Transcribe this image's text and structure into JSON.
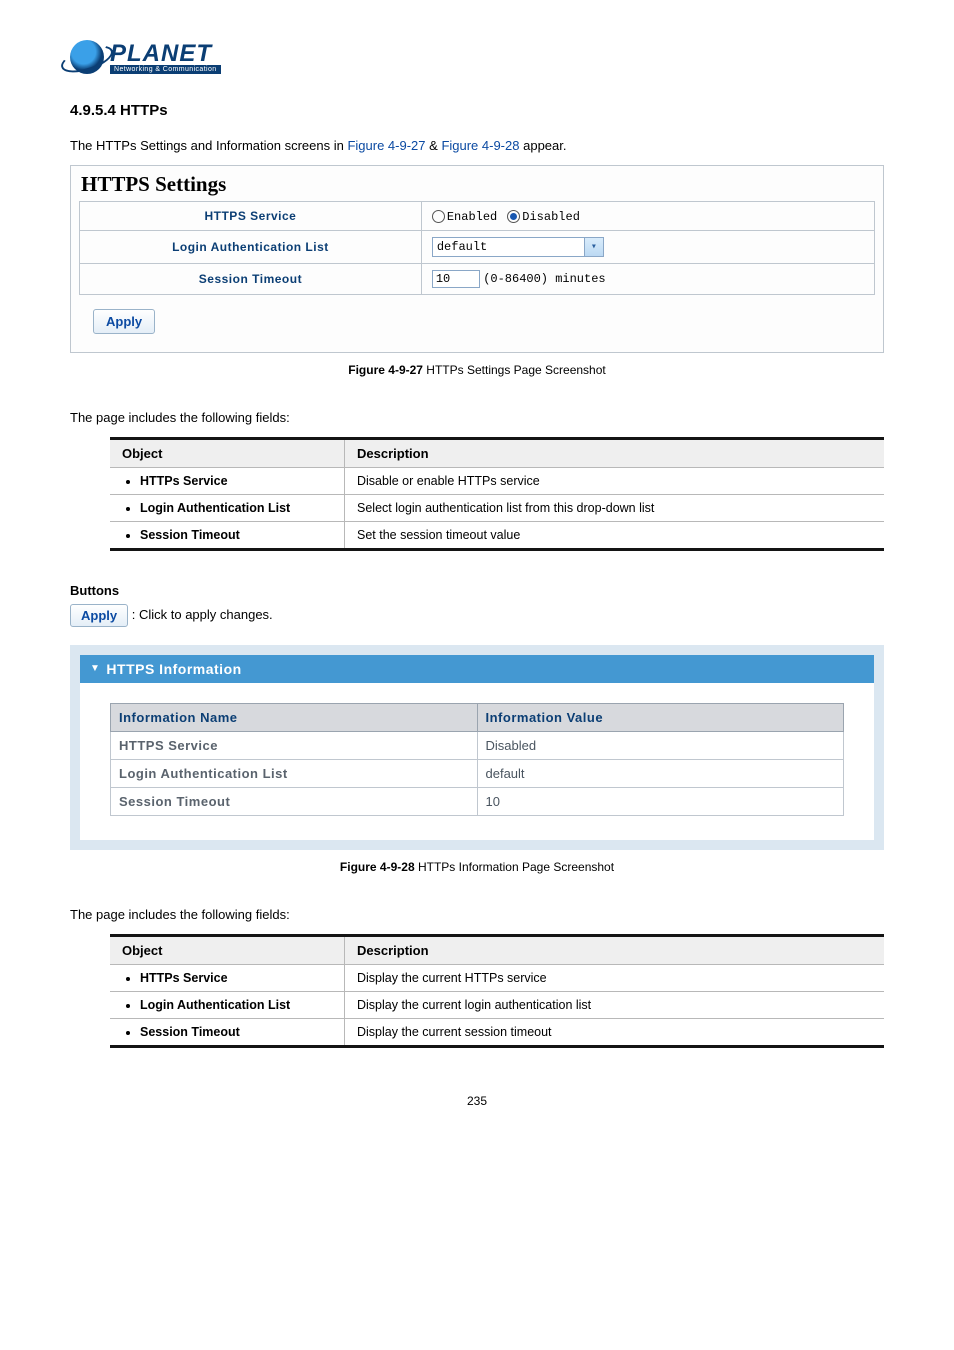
{
  "logo": {
    "name": "PLANET",
    "tagline": "Networking & Communication"
  },
  "section": {
    "number": "4.9.5.4",
    "title": "HTTPs"
  },
  "intro": {
    "prefix": "The HTTPs Settings and Information screens in ",
    "fig1": "Figure 4-9-27",
    "amp": " & ",
    "fig2": "Figure 4-9-28",
    "suffix": " appear."
  },
  "settings_panel": {
    "title": "HTTPS Settings",
    "rows": {
      "https_service": {
        "label": "HTTPS Service",
        "opt_enabled": "Enabled",
        "opt_disabled": "Disabled"
      },
      "auth_list": {
        "label": "Login Authentication List",
        "value": "default"
      },
      "session_timeout": {
        "label": "Session Timeout",
        "value": "10",
        "hint": "(0-86400) minutes"
      }
    },
    "apply": "Apply"
  },
  "caption1": {
    "bold": "Figure 4-9-27",
    "rest": " HTTPs Settings Page Screenshot"
  },
  "fields_intro": "The page includes the following fields:",
  "fields1": {
    "head_object": "Object",
    "head_desc": "Description",
    "rows": [
      {
        "obj": "HTTPs Service",
        "desc": "Disable or enable HTTPs service"
      },
      {
        "obj": "Login Authentication List",
        "desc": "Select login authentication list from this drop-down list"
      },
      {
        "obj": "Session Timeout",
        "desc": "Set the session timeout value"
      }
    ]
  },
  "buttons": {
    "header": "Buttons",
    "apply": "Apply",
    "desc": ": Click to apply changes."
  },
  "info_panel": {
    "title": "HTTPS Information",
    "head_name": "Information Name",
    "head_value": "Information Value",
    "rows": [
      {
        "name": "HTTPS Service",
        "value": "Disabled"
      },
      {
        "name": "Login Authentication List",
        "value": "default"
      },
      {
        "name": "Session Timeout",
        "value": "10"
      }
    ]
  },
  "caption2": {
    "bold": "Figure 4-9-28",
    "rest": " HTTPs Information Page Screenshot"
  },
  "fields2": {
    "head_object": "Object",
    "head_desc": "Description",
    "rows": [
      {
        "obj": "HTTPs Service",
        "desc": "Display the current HTTPs service"
      },
      {
        "obj": "Login Authentication List",
        "desc": "Display the current login authentication list"
      },
      {
        "obj": "Session Timeout",
        "desc": "Display the current session timeout"
      }
    ]
  },
  "page_number": "235"
}
